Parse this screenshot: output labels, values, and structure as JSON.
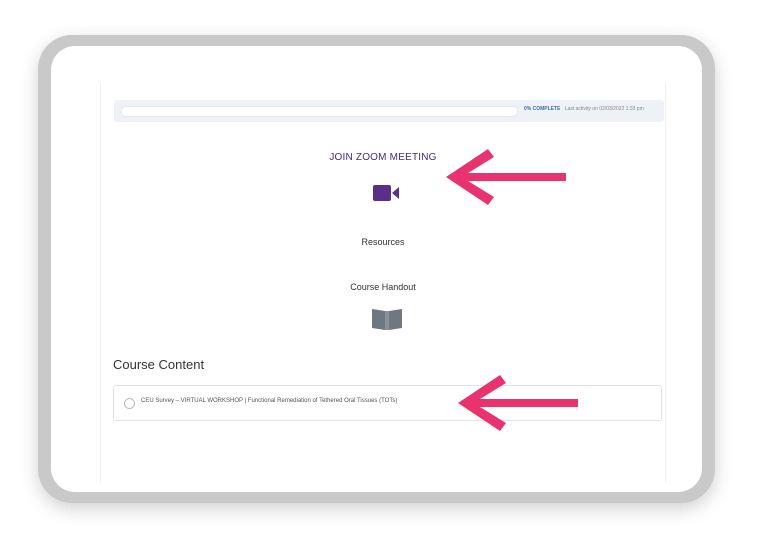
{
  "progress": {
    "value": 0,
    "percent_label": "0% COMPLETE",
    "last_activity": "Last activity on 02/03/2022 1:33 pm",
    "fill_color": "#5b2e8a"
  },
  "main": {
    "zoom_link": "JOIN ZOOM MEETING",
    "zoom_icon": "video-camera-icon",
    "resources_label": "Resources",
    "handout_label": "Course Handout",
    "handout_icon": "book-icon"
  },
  "course_content": {
    "title": "Course Content",
    "items": [
      {
        "label": "CEU Survey – VIRTUAL WORKSHOP | Functional Remediation of Tethered Oral Tissues (TOTs)"
      }
    ]
  },
  "annotations": {
    "arrow_color": "#e8336e"
  },
  "colors": {
    "accent_purple": "#5b2e8a",
    "link_purple": "#4a2a7a",
    "icon_gray": "#6f7780"
  }
}
